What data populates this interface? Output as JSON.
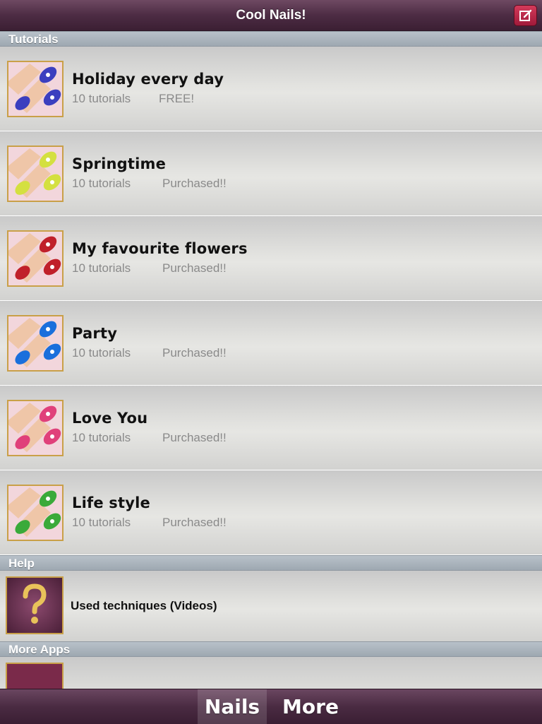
{
  "navbar": {
    "title": "Cool Nails!",
    "compose_icon": "compose-icon"
  },
  "sections": {
    "tutorials": "Tutorials",
    "help": "Help",
    "more_apps": "More Apps"
  },
  "tutorials": [
    {
      "title": "Holiday every day",
      "subtitle": "10 tutorials",
      "status": "FREE!",
      "icon": "nail-thumbnail",
      "accent": "#3b3fbf"
    },
    {
      "title": "Springtime",
      "subtitle": "10 tutorials",
      "status": "Purchased!!",
      "icon": "nail-thumbnail",
      "accent": "#d4e040"
    },
    {
      "title": "My favourite flowers",
      "subtitle": "10 tutorials",
      "status": "Purchased!!",
      "icon": "nail-thumbnail",
      "accent": "#c0202a"
    },
    {
      "title": "Party",
      "subtitle": "10 tutorials",
      "status": "Purchased!!",
      "icon": "nail-thumbnail",
      "accent": "#1a6fdc"
    },
    {
      "title": "Love You",
      "subtitle": "10 tutorials",
      "status": "Purchased!!",
      "icon": "nail-thumbnail",
      "accent": "#e0407a"
    },
    {
      "title": "Life style",
      "subtitle": "10 tutorials",
      "status": "Purchased!!",
      "icon": "nail-thumbnail",
      "accent": "#3aaa3a"
    }
  ],
  "help": {
    "label": "Used techniques (Videos)",
    "icon": "question-icon"
  },
  "tabbar": {
    "tabs": [
      {
        "label": "Nails",
        "active": true
      },
      {
        "label": "More",
        "active": false
      }
    ]
  },
  "colors": {
    "navbar": "#4d2c44",
    "thumb_border": "#c9a048",
    "section_header": "#a9b2bb"
  }
}
